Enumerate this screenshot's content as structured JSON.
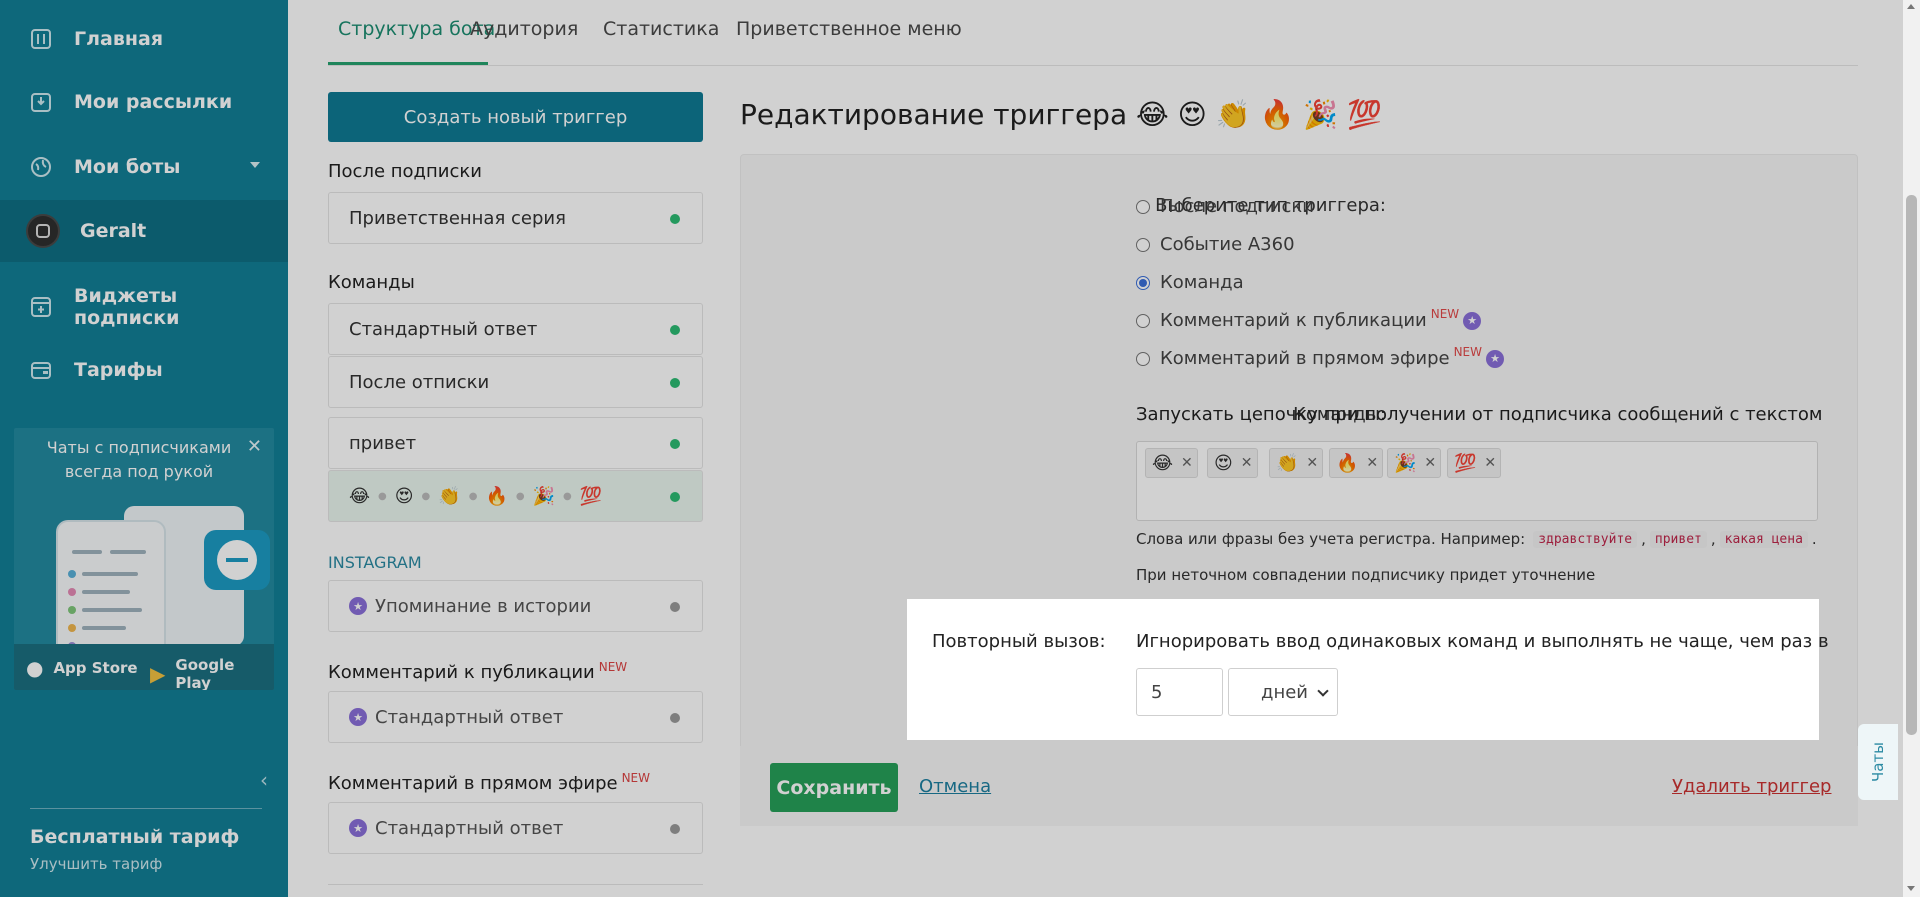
{
  "sidebar": {
    "nav": {
      "home": "Главная",
      "mailings": "Мои рассылки",
      "bots": "Мои боты",
      "user": "Geralt",
      "widgets": "Виджеты подписки",
      "tariffs": "Тарифы"
    },
    "promo": {
      "title": "Чаты с подписчиками всегда под рукой",
      "app_store": "App Store",
      "google_play": "Google Play"
    },
    "plan": {
      "title": "Бесплатный тариф",
      "upgrade": "Улучшить тариф"
    }
  },
  "tabs": [
    "Структура бота",
    "Аудитория",
    "Статистика",
    "Приветственное меню"
  ],
  "left": {
    "create_button": "Создать новый триггер",
    "sections": {
      "after_subscribe": "После подписки",
      "commands": "Команды",
      "instagram": "INSTAGRAM",
      "comment_publication": "Комментарий к публикации",
      "comment_live": "Комментарий в прямом эфире"
    },
    "new_tag": "NEW",
    "items": {
      "welcome_series": "Приветственная серия",
      "standard_reply": "Стандартный ответ",
      "after_unsubscribe": "После отписки",
      "hello": "привет",
      "story_mention": "Упоминание в истории",
      "pub_standard": "Стандартный ответ",
      "live_standard": "Стандартный ответ"
    },
    "selected_emojis": [
      "😂",
      "😍",
      "👏",
      "🔥",
      "🎉",
      "💯"
    ]
  },
  "editor": {
    "title": "Редактирование триггера 😂 😍 👏 🔥 🎉 💯",
    "type_label": "Выберите тип триггера:",
    "types": [
      {
        "label": "После подписки",
        "selected": false,
        "is_new": false
      },
      {
        "label": "Событие A360",
        "selected": false,
        "is_new": false
      },
      {
        "label": "Команда",
        "selected": true,
        "is_new": false
      },
      {
        "label": "Комментарий к публикации",
        "selected": false,
        "is_new": true
      },
      {
        "label": "Комментарий в прямом эфире",
        "selected": false,
        "is_new": true
      }
    ],
    "commands_label": "Команды:",
    "commands_desc": "Запускать цепочку при получении от подписчика сообщений с текстом",
    "tags": [
      "😂",
      "😍",
      "👏",
      "🔥",
      "🎉",
      "💯"
    ],
    "hint_prefix": "Слова или фразы без учета регистра. Например:",
    "hint_examples": [
      "здравствуйте",
      "привет",
      "какая цена"
    ],
    "hint_fuzzy": "При неточном совпадении подписчику придет уточнение",
    "repeat_label": "Повторный вызов:",
    "repeat_desc": "Игнорировать ввод одинаковых команд и выполнять не чаще, чем раз в",
    "repeat_value": "5",
    "repeat_unit": "дней",
    "save": "Сохранить",
    "cancel": "Отмена",
    "delete": "Удалить триггер"
  },
  "chat_tab": "Чаты",
  "colors": {
    "sidebar": "#127f96",
    "accent_green": "#27a05a",
    "primary_button": "#0f7b94",
    "status_active": "#2dbb73",
    "status_inactive": "#9a9a9a",
    "new_tag": "#e24a4a"
  }
}
